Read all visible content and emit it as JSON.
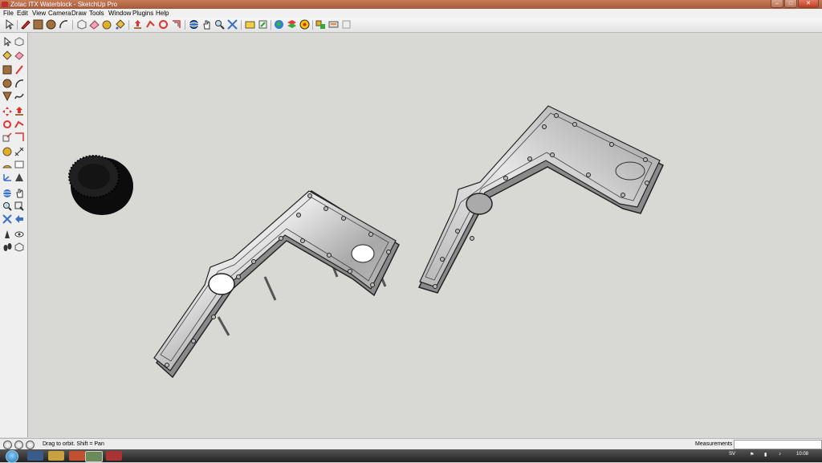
{
  "window": {
    "title": "Zotac ITX Waterblock - SketchUp Pro"
  },
  "menu": [
    "File",
    "Edit",
    "View",
    "Camera",
    "Draw",
    "Tools",
    "Window",
    "Plugins",
    "Help"
  ],
  "toolbar_icons": [
    "select-icon",
    "pencil-icon",
    "rectangle-icon",
    "circle-icon",
    "arc-icon",
    "eraser-icon",
    "paint-bucket-icon",
    "push-pull-icon",
    "offset-icon",
    "move-icon",
    "rotate-icon",
    "follow-me-icon",
    "orbit-icon",
    "pan-icon",
    "zoom-icon",
    "zoom-extents-icon",
    "tape-measure-icon",
    "component-icon",
    "3d-warehouse-icon",
    "google-earth-icon",
    "layers-icon",
    "materials-icon",
    "shadows-icon"
  ],
  "status": {
    "hint": "Drag to orbit.  Shift = Pan",
    "measurements_label": "Measurements",
    "measurements_value": ""
  },
  "taskbar": {
    "lang": "SV",
    "time": "10:08"
  },
  "colors": {
    "titlebar": "#b46648",
    "viewport": "#d8d8d4",
    "model": "#c9c9c9",
    "knob": "#141414"
  }
}
